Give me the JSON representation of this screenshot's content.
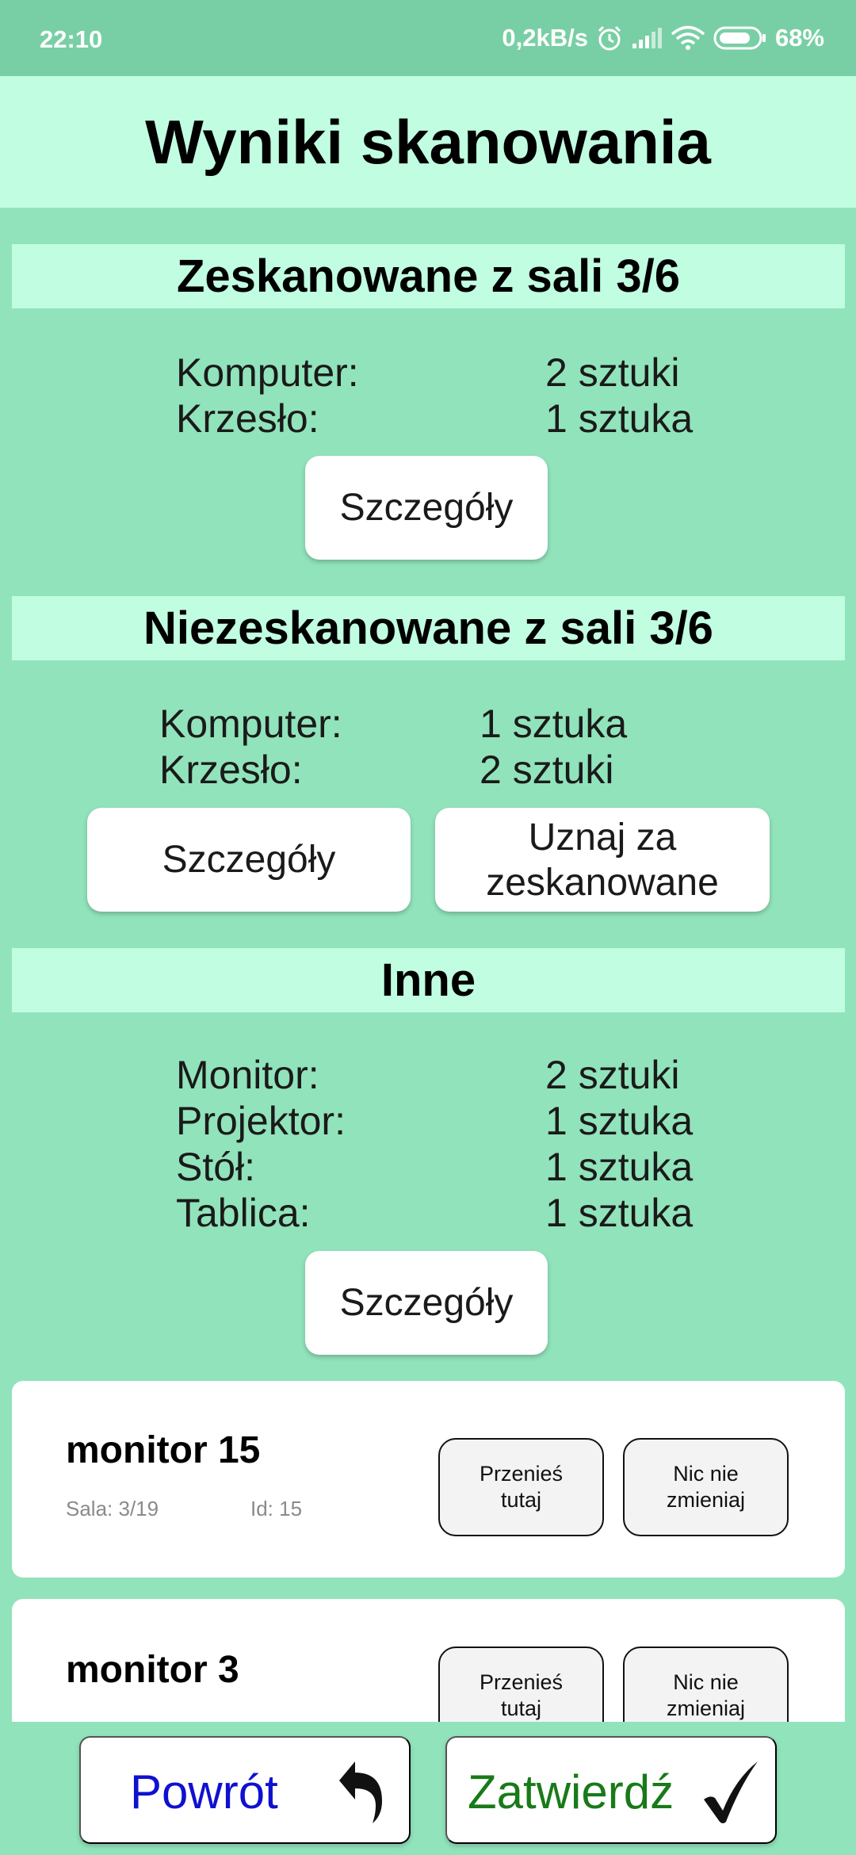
{
  "status_bar": {
    "time": "22:10",
    "network_speed": "0,2kB/s",
    "battery": "68%",
    "icons": [
      "alarm-icon",
      "signal-icon",
      "wifi-icon",
      "battery-icon"
    ]
  },
  "header": {
    "title": "Wyniki skanowania"
  },
  "scanned": {
    "title": "Zeskanowane z sali 3/6",
    "items": [
      {
        "name": "Komputer:",
        "count": "2 sztuki"
      },
      {
        "name": "Krzesło:",
        "count": "1 sztuka"
      }
    ],
    "details_label": "Szczegóły"
  },
  "not_scanned": {
    "title": "Niezeskanowane z sali 3/6",
    "items": [
      {
        "name": "Komputer:",
        "count": "1 sztuka"
      },
      {
        "name": "Krzesło:",
        "count": "2 sztuki"
      }
    ],
    "details_label": "Szczegóły",
    "mark_line1": "Uznaj za",
    "mark_line2": "zeskanowane"
  },
  "others": {
    "title": "Inne",
    "items": [
      {
        "name": "Monitor:",
        "count": "2 sztuki"
      },
      {
        "name": "Projektor:",
        "count": "1 sztuka"
      },
      {
        "name": "Stół:",
        "count": "1 sztuka"
      },
      {
        "name": "Tablica:",
        "count": "1 sztuka"
      }
    ],
    "details_label": "Szczegóły"
  },
  "cards": [
    {
      "title": "monitor 15",
      "room": "Sala: 3/19",
      "id": "Id: 15",
      "move_line1": "Przenieś",
      "move_line2": "tutaj",
      "keep_line1": "Nic nie",
      "keep_line2": "zmieniaj"
    },
    {
      "title": "monitor 3",
      "move_line1": "Przenieś",
      "move_line2": "tutaj",
      "keep_line1": "Nic nie",
      "keep_line2": "zmieniaj"
    }
  ],
  "bottom": {
    "back_label": "Powrót",
    "confirm_label": "Zatwierdź",
    "back_color": "#1010d0",
    "confirm_color": "#187a18"
  }
}
